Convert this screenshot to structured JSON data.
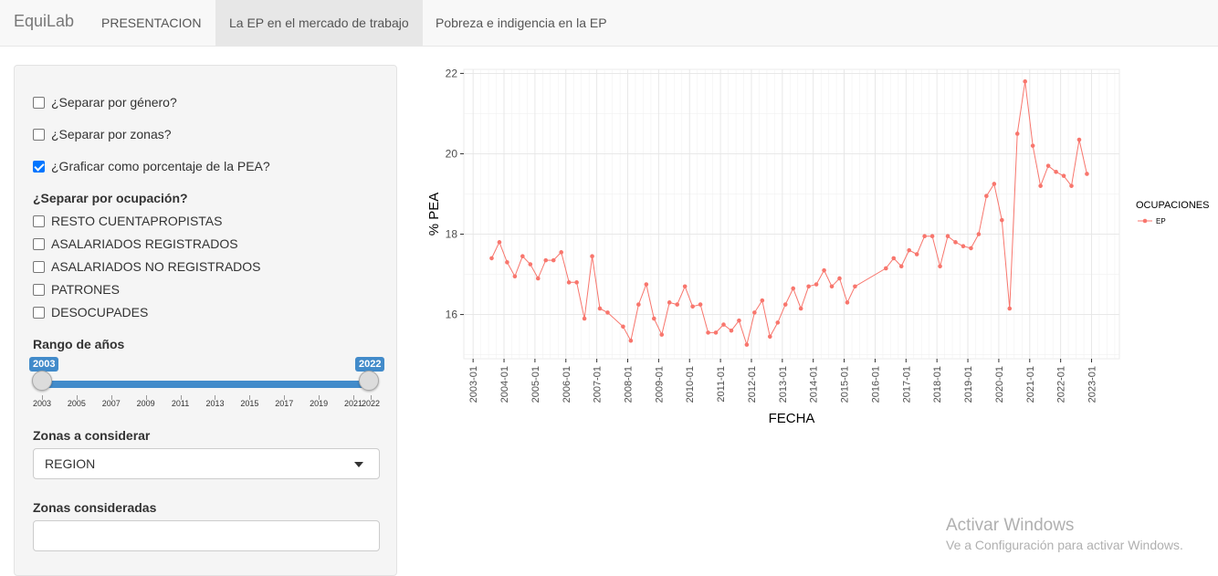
{
  "navbar": {
    "brand": "EquiLab",
    "tabs": [
      {
        "label": "PRESENTACION"
      },
      {
        "label": "La EP en el mercado de trabajo"
      },
      {
        "label": "Pobreza e indigencia en la EP"
      }
    ]
  },
  "sidebar": {
    "checkboxes": [
      {
        "label": "¿Separar por género?",
        "checked": false
      },
      {
        "label": "¿Separar por zonas?",
        "checked": false
      },
      {
        "label": "¿Graficar como porcentaje de la PEA?",
        "checked": true
      }
    ],
    "ocupacion_title": "¿Separar por ocupación?",
    "ocupaciones": [
      {
        "label": "RESTO CUENTAPROPISTAS",
        "checked": false
      },
      {
        "label": "ASALARIADOS REGISTRADOS",
        "checked": false
      },
      {
        "label": "ASALARIADOS NO REGISTRADOS",
        "checked": false
      },
      {
        "label": "PATRONES",
        "checked": false
      },
      {
        "label": "DESOCUPADES",
        "checked": false
      }
    ],
    "rango_title": "Rango de años",
    "slider": {
      "min": 2003,
      "max": 2022,
      "from": 2003,
      "to": 2022,
      "from_label": "2003",
      "to_label": "2022",
      "ticks": [
        "2003",
        "2005",
        "2007",
        "2009",
        "2011",
        "2013",
        "2015",
        "2017",
        "2019",
        "2021",
        "2022"
      ]
    },
    "zonas_title": "Zonas a considerar",
    "zonas_value": "REGION",
    "consideradas_title": "Zonas consideradas",
    "consideradas_value": ""
  },
  "watermark": {
    "line1": "Activar Windows",
    "line2": "Ve a Configuración para activar Windows."
  },
  "chart_data": {
    "type": "line",
    "xlabel": "FECHA",
    "ylabel": "% PEA",
    "ylim": [
      14.9,
      22.1
    ],
    "xlim": [
      2002.7,
      2023.9
    ],
    "yticks": [
      16,
      18,
      20,
      22
    ],
    "xticks": [
      "2003-01",
      "2004-01",
      "2005-01",
      "2006-01",
      "2007-01",
      "2008-01",
      "2009-01",
      "2010-01",
      "2011-01",
      "2012-01",
      "2013-01",
      "2014-01",
      "2015-01",
      "2016-01",
      "2017-01",
      "2018-01",
      "2019-01",
      "2020-01",
      "2021-01",
      "2022-01",
      "2023-01"
    ],
    "grid": true,
    "legend": {
      "title": "OCUPACIONES",
      "placement": "right"
    },
    "color": "#f8766d",
    "series": [
      {
        "name": "EP",
        "x": [
          2003.6,
          2003.85,
          2004.1,
          2004.35,
          2004.6,
          2004.85,
          2005.1,
          2005.35,
          2005.6,
          2005.85,
          2006.1,
          2006.35,
          2006.6,
          2006.85,
          2007.1,
          2007.35,
          2007.85,
          2008.1,
          2008.35,
          2008.6,
          2008.85,
          2009.1,
          2009.35,
          2009.6,
          2009.85,
          2010.1,
          2010.35,
          2010.6,
          2010.85,
          2011.1,
          2011.35,
          2011.6,
          2011.85,
          2012.1,
          2012.35,
          2012.6,
          2012.85,
          2013.1,
          2013.35,
          2013.6,
          2013.85,
          2014.1,
          2014.35,
          2014.6,
          2014.85,
          2015.1,
          2015.35,
          2016.35,
          2016.6,
          2016.85,
          2017.1,
          2017.35,
          2017.6,
          2017.85,
          2018.1,
          2018.35,
          2018.6,
          2018.85,
          2019.1,
          2019.35,
          2019.6,
          2019.85,
          2020.1,
          2020.35,
          2020.6,
          2020.85,
          2021.1,
          2021.35,
          2021.6,
          2021.85,
          2022.1,
          2022.35,
          2022.6,
          2022.85
        ],
        "y": [
          17.4,
          17.8,
          17.3,
          16.95,
          17.45,
          17.25,
          16.9,
          17.35,
          17.35,
          17.55,
          16.8,
          16.8,
          15.9,
          17.45,
          16.15,
          16.05,
          15.7,
          15.35,
          16.25,
          16.75,
          15.9,
          15.5,
          16.3,
          16.25,
          16.7,
          16.2,
          16.25,
          15.55,
          15.55,
          15.75,
          15.6,
          15.85,
          15.25,
          16.05,
          16.35,
          15.45,
          15.8,
          16.25,
          16.65,
          16.15,
          16.7,
          16.75,
          17.1,
          16.7,
          16.9,
          16.3,
          16.7,
          17.15,
          17.4,
          17.2,
          17.6,
          17.5,
          17.95,
          17.95,
          17.2,
          17.95,
          17.8,
          17.7,
          17.65,
          18.0,
          18.95,
          19.25,
          18.35,
          16.15,
          20.5,
          21.8,
          20.2,
          19.2,
          19.7,
          19.55,
          19.45,
          19.2,
          20.35,
          19.5
        ]
      }
    ]
  }
}
